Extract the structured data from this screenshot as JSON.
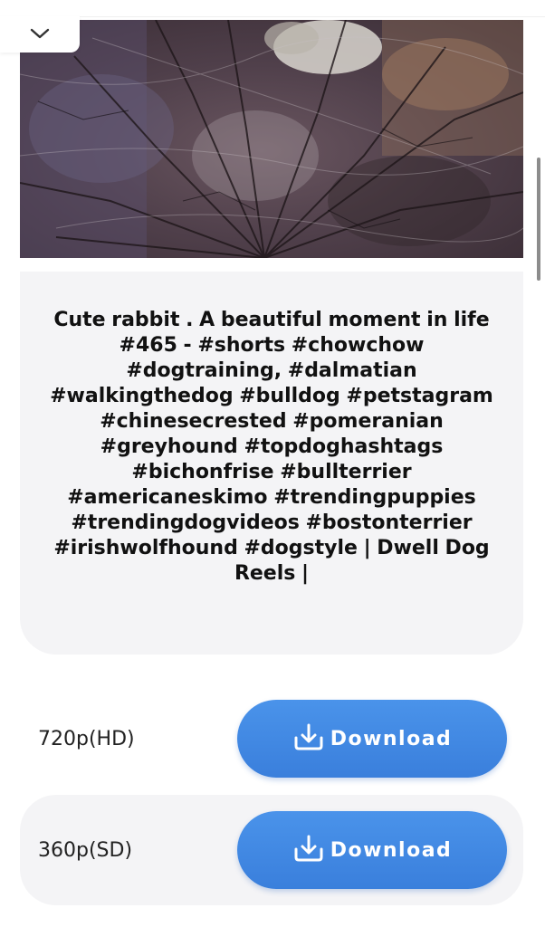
{
  "header": {
    "collapse_icon": "chevron-down-icon"
  },
  "video": {
    "title": "Cute rabbit . A beautiful moment in life #465 - #shorts #chowchow #dogtraining, #dalmatian #walkingthedog #bulldog #petstagram #chinesecrested #pomeranian #greyhound #topdoghashtags #bichonfrise #bullterrier #americaneskimo #trendingpuppies #trendingdogvideos #bostonterrier #irishwolfhound #dogstyle | Dwell Dog Reels |"
  },
  "downloads": [
    {
      "quality": "720p(HD)",
      "button_label": "Download",
      "icon": "download-icon"
    },
    {
      "quality": "360p(SD)",
      "button_label": "Download",
      "icon": "download-icon"
    }
  ],
  "colors": {
    "button": "#3f86e2",
    "card_background": "#f4f4f6",
    "text": "#111111"
  }
}
